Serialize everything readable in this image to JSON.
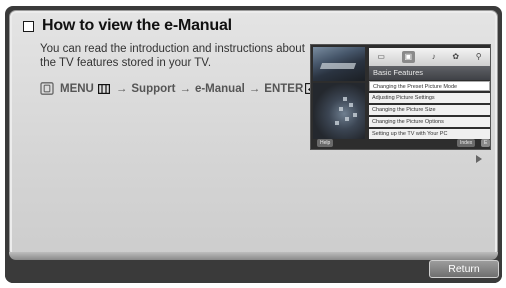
{
  "title": "How to view the e-Manual",
  "description": "You can read the introduction and instructions about the TV features stored in your TV.",
  "navigation": {
    "menu": "MENU",
    "arrow": "→",
    "support": "Support",
    "emanual": "e-Manual",
    "enter": "ENTER"
  },
  "preview": {
    "section_title": "Basic Features",
    "items": [
      "Changing the Preset Picture Mode",
      "Adjusting Picture Settings",
      "Changing the Picture Size",
      "Changing the Picture Options",
      "Setting up the TV with Your PC"
    ],
    "help_label": "Help",
    "index_label": "Index",
    "close_label": "E"
  },
  "return_label": "Return"
}
